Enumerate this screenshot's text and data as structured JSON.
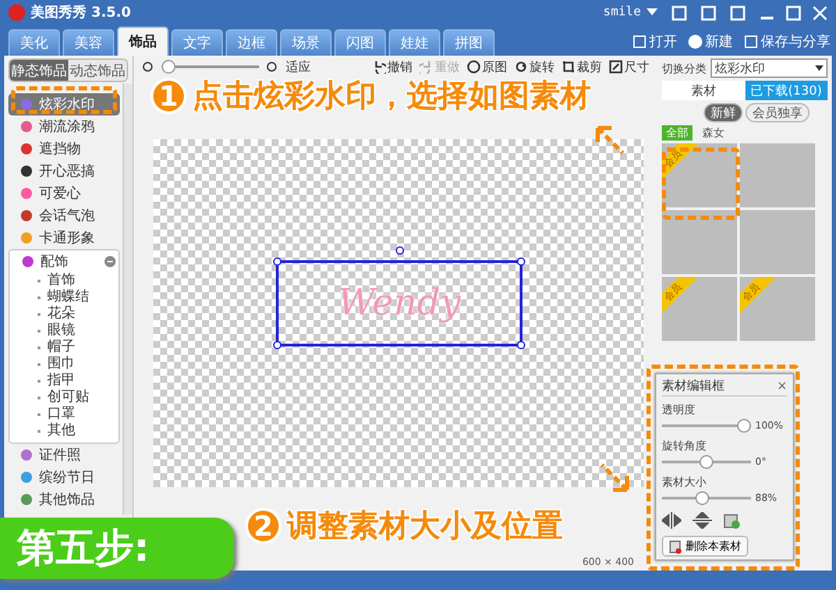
{
  "window": {
    "title": "美图秀秀 3.5.0",
    "user": "smile"
  },
  "tabs": [
    {
      "label": "美化",
      "selected": false
    },
    {
      "label": "美容",
      "selected": false
    },
    {
      "label": "饰品",
      "selected": true
    },
    {
      "label": "文字",
      "selected": false
    },
    {
      "label": "边框",
      "selected": false
    },
    {
      "label": "场景",
      "selected": false
    },
    {
      "label": "闪图",
      "selected": false
    },
    {
      "label": "娃娃",
      "selected": false
    },
    {
      "label": "拼图",
      "selected": false
    }
  ],
  "top_actions": [
    {
      "kind": "open",
      "label": "打开"
    },
    {
      "kind": "new",
      "label": "新建"
    },
    {
      "kind": "save",
      "label": "保存与分享"
    }
  ],
  "sidebar": {
    "modes": [
      {
        "label": "静态饰品",
        "selected": true
      },
      {
        "label": "动态饰品",
        "selected": false
      }
    ],
    "items": [
      {
        "label": "炫彩水印",
        "selected": true
      },
      {
        "label": "潮流涂鸦",
        "selected": false
      },
      {
        "label": "遮挡物",
        "selected": false
      },
      {
        "label": "开心恶搞",
        "selected": false
      },
      {
        "label": "可爱心",
        "selected": false
      },
      {
        "label": "会话气泡",
        "selected": false
      },
      {
        "label": "卡通形象",
        "selected": false
      },
      {
        "label": "配饰",
        "selected": false,
        "expanded": true,
        "children": [
          {
            "label": "首饰"
          },
          {
            "label": "蝴蝶结"
          },
          {
            "label": "花朵"
          },
          {
            "label": "眼镜"
          },
          {
            "label": "帽子"
          },
          {
            "label": "围巾"
          },
          {
            "label": "指甲"
          },
          {
            "label": "创可贴"
          },
          {
            "label": "口罩"
          },
          {
            "label": "其他"
          }
        ]
      },
      {
        "label": "证件照",
        "selected": false
      },
      {
        "label": "缤纷节日",
        "selected": false
      },
      {
        "label": "其他饰品",
        "selected": false
      }
    ]
  },
  "toolbar": {
    "zoom": {
      "level": 0
    },
    "fit": "适应",
    "actions": [
      {
        "kind": "undo",
        "label": "撤销",
        "disabled": false
      },
      {
        "kind": "redo",
        "label": "重做",
        "disabled": true
      },
      {
        "kind": "original",
        "label": "原图",
        "disabled": false
      },
      {
        "kind": "rotate",
        "label": "旋转",
        "disabled": false
      },
      {
        "kind": "crop",
        "label": "裁剪",
        "disabled": false
      },
      {
        "kind": "resize",
        "label": "尺寸",
        "disabled": false
      }
    ]
  },
  "canvas": {
    "watermark": "Wendy",
    "size": "600 × 400"
  },
  "right_panel": {
    "category_label": "切换分类",
    "category": "炫彩水印",
    "tabs": [
      {
        "label": "素材",
        "selected": false
      },
      {
        "label": "已下载(130)",
        "selected": true
      }
    ],
    "subtabs": [
      {
        "label": "新鲜",
        "selected": true
      },
      {
        "label": "会员独享",
        "selected": false
      }
    ],
    "filters": [
      {
        "label": "全部",
        "selected": true
      },
      {
        "label": "森女",
        "selected": false
      }
    ],
    "thumbnails": [
      {
        "kind": "member",
        "badge": "会员"
      },
      {
        "kind": "free"
      },
      {
        "kind": "free"
      },
      {
        "kind": "free"
      },
      {
        "kind": "member",
        "badge": "会员"
      },
      {
        "kind": "member",
        "badge": "会员"
      }
    ]
  },
  "edit_dialog": {
    "title": "素材编辑框",
    "close": "×",
    "sliders": [
      {
        "label": "透明度",
        "level": 1,
        "reading": "100%"
      },
      {
        "label": "旋转角度",
        "level": 0.5,
        "reading": "0°"
      },
      {
        "label": "素材大小",
        "level": 0.44,
        "reading": "88%"
      }
    ],
    "delete": "删除本素材"
  },
  "callouts": [
    {
      "number": "1",
      "text": "点击炫彩水印，选择如图素材"
    },
    {
      "number": "2",
      "text": "调整素材大小及位置"
    }
  ],
  "step_badge": "第五步:"
}
